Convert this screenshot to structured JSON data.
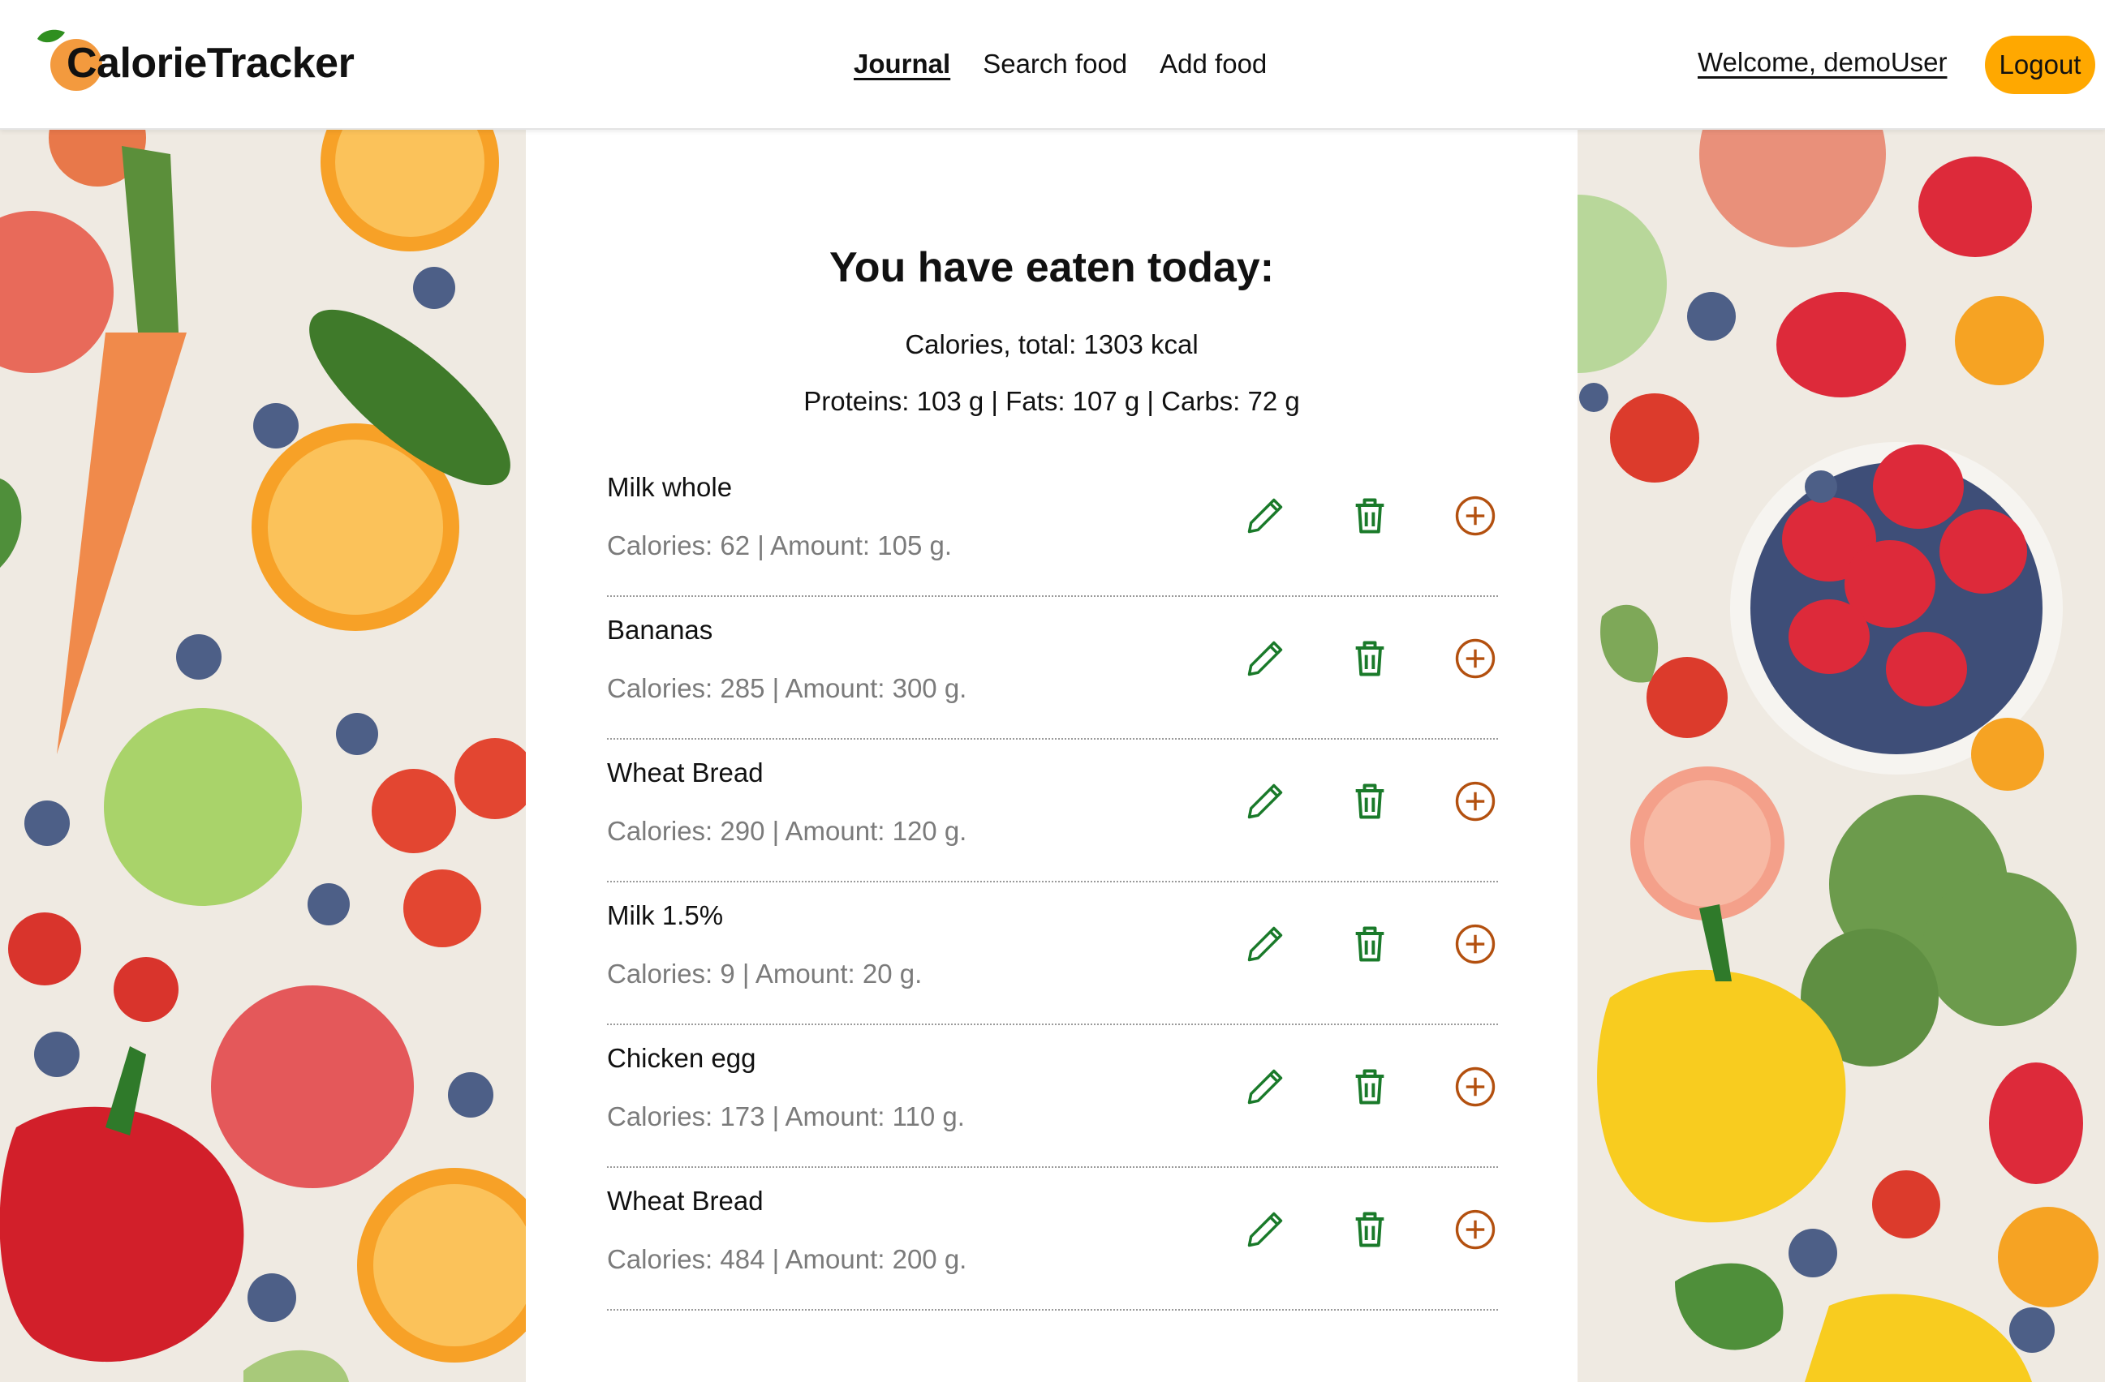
{
  "app": {
    "logo_text": "CalorieTracker"
  },
  "nav": [
    {
      "label": "Journal",
      "active": true
    },
    {
      "label": "Search food",
      "active": false
    },
    {
      "label": "Add food",
      "active": false
    }
  ],
  "user": {
    "welcome": "Welcome, demoUser",
    "logout_label": "Logout"
  },
  "summary": {
    "title": "You have eaten today:",
    "total_calories": "Calories, total: 1303 kcal",
    "macros": "Proteins: 103 g | Fats: 107 g | Carbs: 72 g"
  },
  "entries": [
    {
      "name": "Milk whole",
      "detail": "Calories: 62 | Amount: 105 g."
    },
    {
      "name": "Bananas",
      "detail": "Calories: 285 | Amount: 300 g."
    },
    {
      "name": "Wheat Bread",
      "detail": "Calories: 290 | Amount: 120 g."
    },
    {
      "name": "Milk 1.5%",
      "detail": "Calories: 9 | Amount: 20 g."
    },
    {
      "name": "Chicken egg",
      "detail": "Calories: 173 | Amount: 110 g."
    },
    {
      "name": "Wheat Bread",
      "detail": "Calories: 484 | Amount: 200 g."
    }
  ],
  "icons": {
    "edit": "pencil-icon",
    "delete": "trash-icon",
    "add": "plus-circle-icon"
  },
  "colors": {
    "accent": "#ffa800",
    "icon_green": "#1a7a2a",
    "icon_orange": "#b3500f",
    "detail_gray": "#7b7b7b"
  }
}
